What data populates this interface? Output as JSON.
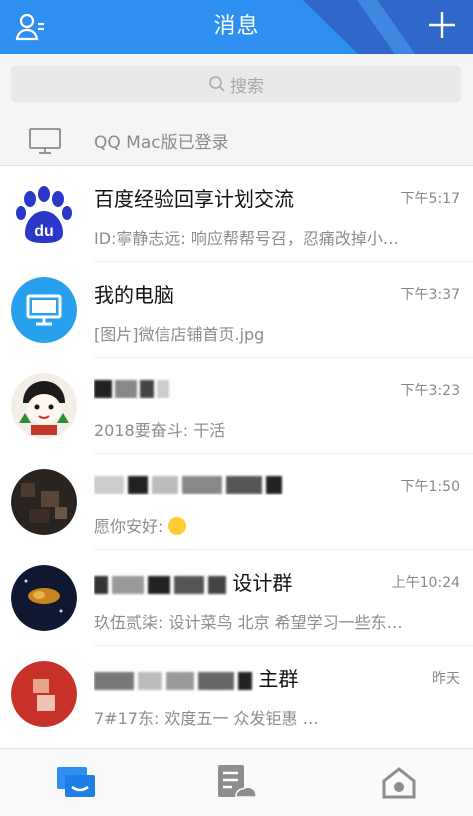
{
  "header": {
    "title": "消息",
    "contacts_icon": "contacts-icon",
    "plus_icon": "plus-icon",
    "bg": "#2d8ff0",
    "accent": "#3068c9"
  },
  "search": {
    "placeholder": "搜索",
    "icon": "search-icon"
  },
  "login_notice": {
    "text": "QQ Mac版已登录",
    "icon": "monitor-icon"
  },
  "conversations": [
    {
      "name": "百度经验回享计划交流",
      "time": "下午5:17",
      "preview": "ID:寧静志远: 响应帮帮号召，忍痛改掉小…",
      "avatar": "baidu-paw-avatar"
    },
    {
      "name": "我的电脑",
      "time": "下午3:37",
      "preview": "[图片]微信店铺首页.jpg",
      "avatar": "computer-avatar"
    },
    {
      "name": "",
      "time": "下午3:23",
      "preview": "2018要奋斗: 干活",
      "avatar": "cartoon-avatar"
    },
    {
      "name": "",
      "time": "下午1:50",
      "preview": "愿你安好: ",
      "avatar": "dark-avatar"
    },
    {
      "name": "设计群",
      "time": "上午10:24",
      "preview": "玖伍贰柒: 设计菜鸟  北京 希望学习一些东…",
      "avatar": "space-avatar"
    },
    {
      "name": "主群",
      "time": "昨天",
      "preview": "7#17东:        欢度五一   众发钜惠        …",
      "avatar": "red-avatar"
    }
  ],
  "tabbar": {
    "tabs": [
      "messages-tab-icon",
      "docs-tab-icon",
      "space-tab-icon"
    ],
    "active": "#2d8ff0"
  }
}
